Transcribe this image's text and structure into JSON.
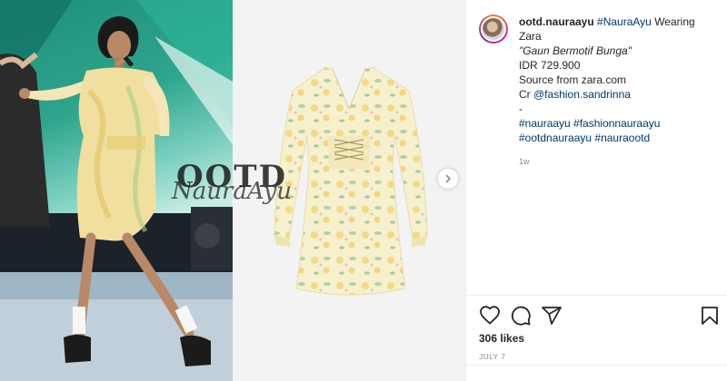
{
  "post": {
    "username": "ootd.nauraayu",
    "caption_hashtag_head": "#NauraAyu",
    "caption_line1_rest": " Wearing",
    "caption_line2": "Zara",
    "caption_line3": "\"Gaun Bermotif Bunga\"",
    "caption_line4": "IDR 729.900",
    "caption_line5": "Source from zara.com",
    "caption_cr_prefix": "Cr ",
    "caption_cr_mention": "@fashion.sandrinna",
    "caption_dash": "-",
    "hashtags_line1": "#nauraayu #fashionnauraayu",
    "hashtags_line2": "#ootdnauraayu #nauraootd",
    "age": "1w",
    "likes": "306 likes",
    "date": "JULY 7"
  },
  "watermark": {
    "top": "OOTD",
    "sub": "NauraAyu"
  },
  "icons": {
    "like": "heart-icon",
    "comment": "comment-icon",
    "share": "paper-plane-icon",
    "save": "bookmark-icon",
    "next": "chevron-right-icon"
  },
  "colors": {
    "link": "#00376b",
    "text": "#262626",
    "muted": "#8e8e8e"
  }
}
